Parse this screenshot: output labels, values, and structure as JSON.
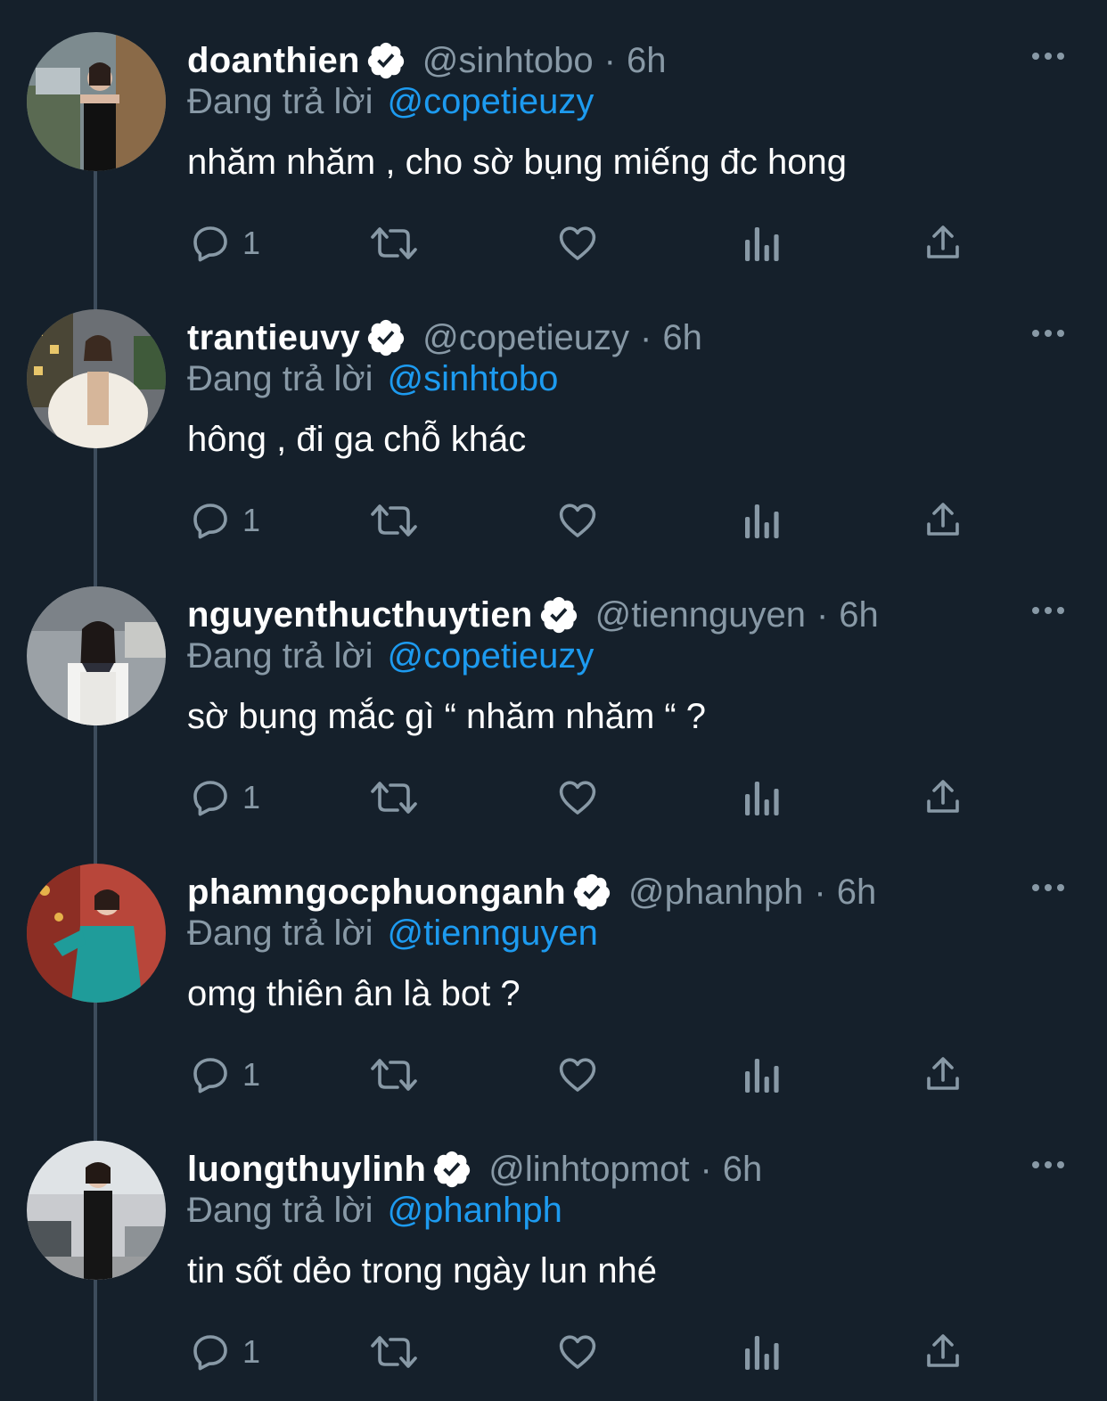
{
  "colors": {
    "background": "#15202b",
    "text_primary": "#ffffff",
    "text_secondary": "#8899a6",
    "link": "#1d9bf0",
    "thread_line": "#3d4c5c"
  },
  "icons": {
    "verified": "verified-badge-icon",
    "more": "more-options-icon",
    "reply": "reply-bubble-icon",
    "retweet": "retweet-icon",
    "like": "heart-icon",
    "views": "views-bar-chart-icon",
    "share": "share-upload-icon"
  },
  "tweets": [
    {
      "display_name": "doanthien",
      "handle": "@sinhtobo",
      "separator": "·",
      "time": "6h",
      "reply_prefix": "Đang trả lời",
      "reply_to": "@copetieuzy",
      "text": " nhăm nhăm , cho sờ bụng miếng đc hong",
      "reply_count": "1"
    },
    {
      "display_name": "trantieuvy",
      "handle": "@copetieuzy",
      "separator": "·",
      "time": "6h",
      "reply_prefix": "Đang trả lời",
      "reply_to": "@sinhtobo",
      "text": "hông , đi ga chỗ khác",
      "reply_count": "1"
    },
    {
      "display_name": "nguyenthucthuytien",
      "handle": "@tiennguyen",
      "separator": "·",
      "time": "6h",
      "reply_prefix": "Đang trả lời",
      "reply_to": "@copetieuzy",
      "text": "sờ bụng mắc gì “ nhăm nhăm “ ?",
      "reply_count": "1"
    },
    {
      "display_name": "phamngocphuonganh",
      "handle": "@phanhph",
      "separator": "·",
      "time": "6h",
      "reply_prefix": "Đang trả lời",
      "reply_to": "@tiennguyen",
      "text": "omg thiên ân là bot ?",
      "reply_count": "1"
    },
    {
      "display_name": "luongthuylinh",
      "handle": "@linhtopmot",
      "separator": "·",
      "time": "6h",
      "reply_prefix": "Đang trả lời",
      "reply_to": "@phanhph",
      "text": "tin sốt dẻo trong ngày lun nhé",
      "reply_count": "1"
    }
  ]
}
